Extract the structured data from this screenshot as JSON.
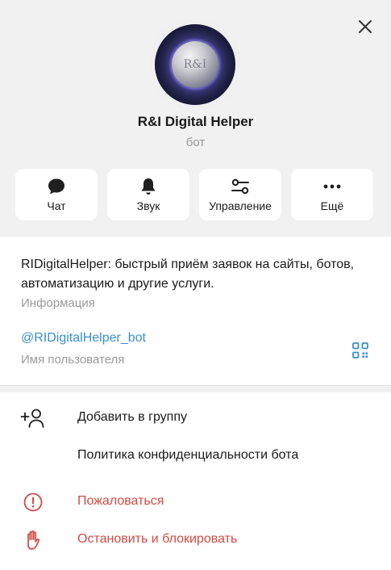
{
  "header": {
    "close_icon": "close-icon",
    "avatar_text": "R&I",
    "title": "R&I Digital Helper",
    "subtitle": "бот"
  },
  "actions": [
    {
      "label": "Чат",
      "icon": "chat-bubble-icon"
    },
    {
      "label": "Звук",
      "icon": "bell-icon"
    },
    {
      "label": "Управление",
      "icon": "sliders-icon"
    },
    {
      "label": "Ещё",
      "icon": "more-dots-icon"
    }
  ],
  "info": {
    "description": "RIDigitalHelper: быстрый приём заявок на сайты, ботов, автоматизацию и другие услуги.",
    "description_label": "Информация",
    "username": "@RIDigitalHelper_bot",
    "username_label": "Имя пользователя",
    "qr_icon": "qr-code-icon"
  },
  "menu": [
    {
      "label": "Добавить в группу",
      "icon": "add-user-icon",
      "danger": false
    },
    {
      "label": "Политика конфиденциальности бота",
      "icon": "",
      "danger": false
    },
    {
      "label": "Пожаловаться",
      "icon": "alert-circle-icon",
      "danger": true
    },
    {
      "label": "Остановить и блокировать",
      "icon": "hand-stop-icon",
      "danger": true
    }
  ],
  "colors": {
    "header_bg": "#f1f1f1",
    "link": "#3a8fc9",
    "danger": "#d14a44",
    "muted_text": "#9a9a9a"
  }
}
